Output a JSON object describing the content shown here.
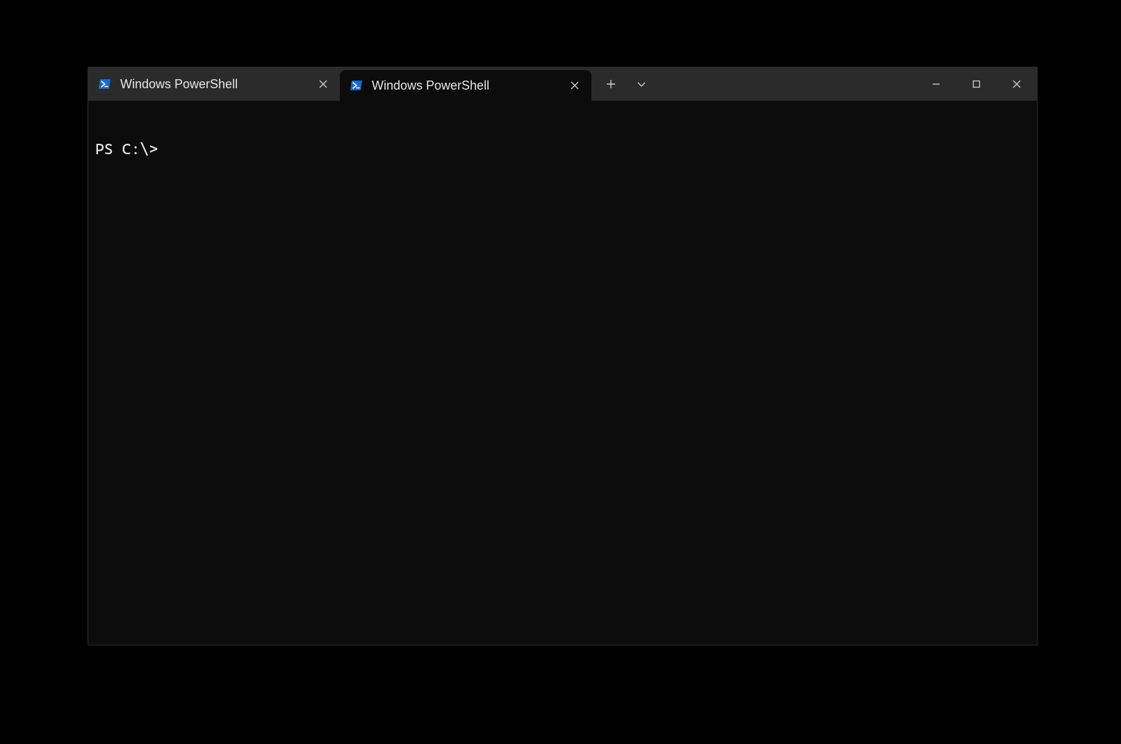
{
  "tabs": [
    {
      "title": "Windows PowerShell",
      "active": false
    },
    {
      "title": "Windows PowerShell",
      "active": true
    }
  ],
  "terminal": {
    "prompt": "PS C:\\>"
  },
  "icons": {
    "new_tab": "+",
    "dropdown": "v",
    "close": "×",
    "minimize": "—",
    "maximize": "☐"
  }
}
